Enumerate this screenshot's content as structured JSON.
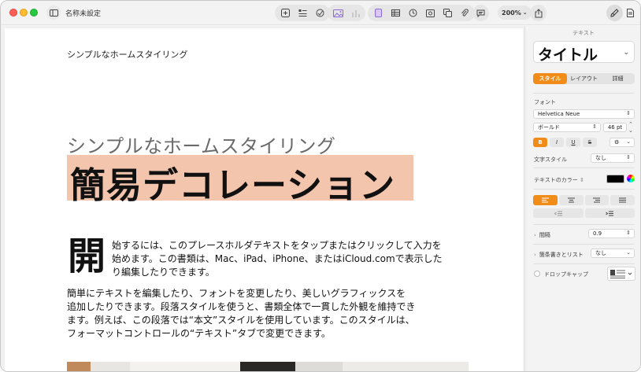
{
  "window": {
    "title": "名称未設定"
  },
  "toolbar": {
    "zoom": "200%",
    "items": [
      "sidebar-icon",
      "add-page-icon",
      "list-icon",
      "shapes-icon",
      "image-icon",
      "chart-icon",
      "text-box-icon",
      "table-icon",
      "clock-icon",
      "media-icon",
      "copy-icon",
      "attach-icon",
      "comment-icon",
      "share-icon",
      "format-brush-icon",
      "document-icon"
    ]
  },
  "document": {
    "header": "シンプルなホームスタイリング",
    "subtitle": "シンプルなホームスタイリング",
    "title": "簡易デコレーション",
    "dropcap": "開",
    "paragraph1": [
      "始するには、このプレースホルダテキストをタップまたはクリックして入力を",
      "始めます。この書類は、Mac、iPad、iPhone、またはiCloud.comで表示した",
      "り編集したりできます。"
    ],
    "paragraph2": [
      "簡単にテキストを編集したり、フォントを変更したり、美しいグラフィックスを",
      "追加したりできます。段落スタイルを使うと、書類全体で一貫した外観を維持でき",
      "ます。例えば、この段落では“本文”スタイルを使用しています。このスタイルは、",
      "フォーマットコントロールの“テキスト”タブで変更できます。"
    ]
  },
  "inspector": {
    "header": "テキスト",
    "paragraph_style": "タイトル",
    "tabs": [
      "スタイル",
      "レイアウト",
      "詳細"
    ],
    "active_tab": "スタイル",
    "font_label": "フォント",
    "font_family": "Helvetica Neue",
    "font_weight": "ボールド",
    "font_size": "46 pt",
    "format_buttons": [
      "B",
      "I",
      "U",
      "S"
    ],
    "char_style_label": "文字スタイル",
    "char_style_value": "なし",
    "text_color_label": "テキストのカラー",
    "spacing_label": "間隔",
    "spacing_value": "0.9",
    "bullets_label": "箇条書きとリスト",
    "bullets_value": "なし",
    "dropcap_label": "ドロップキャップ",
    "accent_color": "#f28c18"
  }
}
